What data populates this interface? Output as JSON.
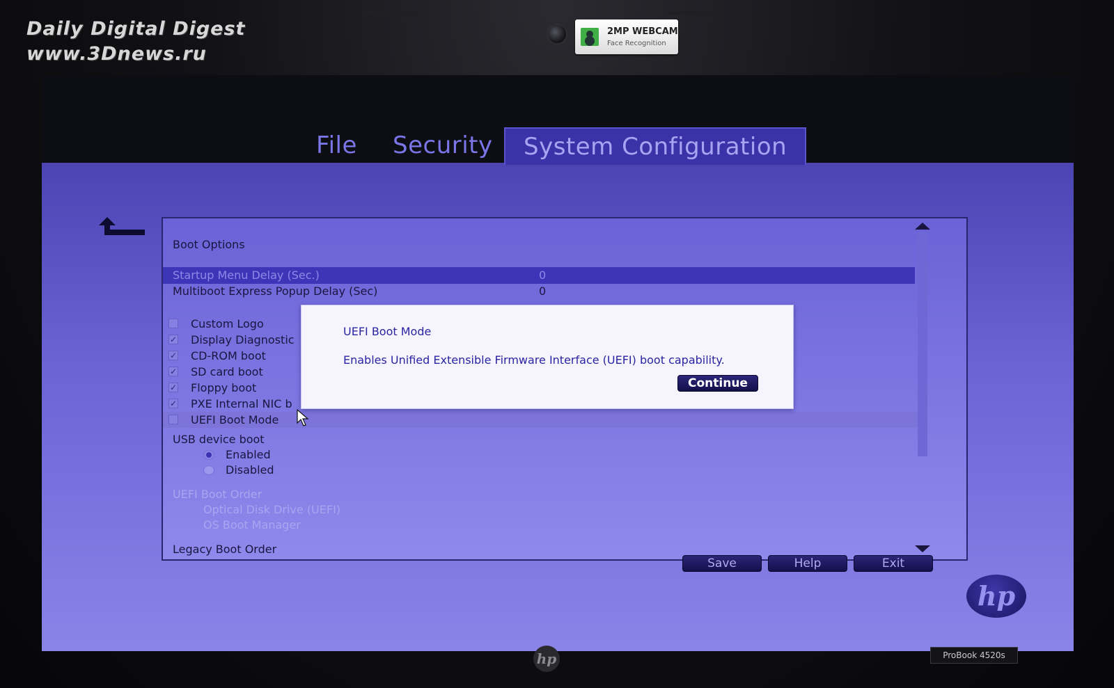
{
  "watermark": {
    "line1": "Daily Digital Digest",
    "line2": "www.3Dnews.ru"
  },
  "webcam": {
    "title": "2MP WEBCAM",
    "subtitle": "Face Recognition"
  },
  "tabs": [
    {
      "label": "File",
      "active": false
    },
    {
      "label": "Security",
      "active": false
    },
    {
      "label": "System Configuration",
      "active": true
    }
  ],
  "icons": {
    "back": "back-arrow-icon",
    "cursor": "mouse-cursor-icon",
    "logo": "hp-logo-icon"
  },
  "panel": {
    "title": "Boot Options",
    "delays": [
      {
        "label": "Startup Menu Delay (Sec.)",
        "value": "0",
        "selected": true
      },
      {
        "label": "Multiboot Express Popup Delay (Sec)",
        "value": "0",
        "selected": false
      }
    ],
    "checkboxes": [
      {
        "label": "Custom Logo",
        "checked": false
      },
      {
        "label": "Display Diagnostic",
        "checked": true
      },
      {
        "label": "CD-ROM boot",
        "checked": true
      },
      {
        "label": "SD card boot",
        "checked": true
      },
      {
        "label": "Floppy boot",
        "checked": true
      },
      {
        "label": "PXE Internal NIC b",
        "checked": true
      },
      {
        "label": "UEFI Boot Mode",
        "checked": false
      }
    ],
    "usb": {
      "label": "USB device boot",
      "options": [
        {
          "label": "Enabled",
          "selected": true
        },
        {
          "label": "Disabled",
          "selected": false
        }
      ]
    },
    "uefi_order": {
      "label": "UEFI Boot Order",
      "items": [
        "Optical Disk Drive (UEFI)",
        "OS Boot Manager"
      ]
    },
    "legacy_order": {
      "label": "Legacy Boot Order"
    }
  },
  "dialog": {
    "title": "UEFI Boot Mode",
    "body": "Enables Unified Extensible Firmware Interface (UEFI) boot capability.",
    "button": "Continue"
  },
  "buttons": {
    "save": "Save",
    "help": "Help",
    "exit": "Exit"
  },
  "brand": {
    "logo_text": "hp",
    "model": "ProBook 4520s"
  },
  "colors": {
    "screen_bg": "#6a61d4",
    "selected_row": "#3d35b8",
    "dialog_text": "#2b24a2",
    "button_bg": "#14104a"
  }
}
